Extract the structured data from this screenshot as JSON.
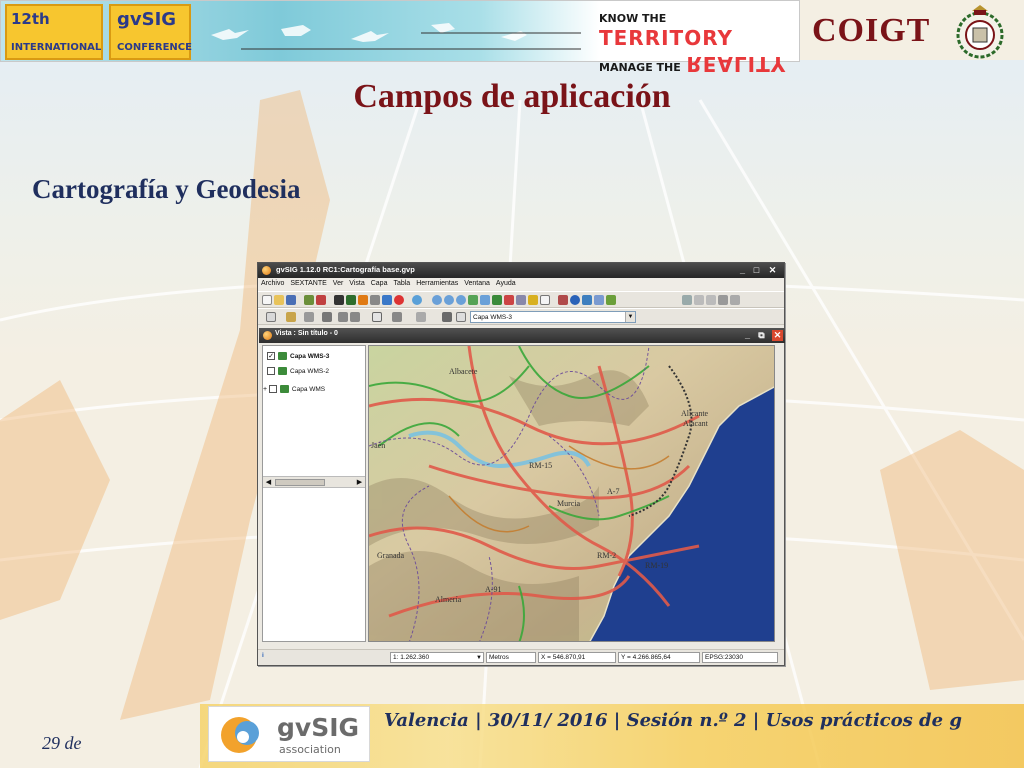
{
  "slide": {
    "title": "Campos de aplicación",
    "subtitle": "Cartografía y Geodesia",
    "org_name": "COIGT",
    "banner": {
      "badge1_line1": "12th",
      "badge1_line2": "INTERNATIONAL",
      "badge2_line1": "gvSIG",
      "badge2_line2": "CONFERENCE",
      "tagline_small_1": "KNOW THE",
      "tagline_large_1": "TERRITORY",
      "tagline_small_2": "MANAGE THE",
      "tagline_large_2": "REALITY"
    },
    "footer": {
      "text": "Valencia | 30/11/ 2016 | Sesión n.º 2 | Usos prácticos de g",
      "page": "29 de",
      "logo_text": "gvSIG",
      "logo_sub": "association"
    }
  },
  "app": {
    "window_title": "gvSIG 1.12.0 RC1:Cartografía base.gvp",
    "menu": [
      "Archivo",
      "SEXTANTE",
      "Ver",
      "Vista",
      "Capa",
      "Tabla",
      "Herramientas",
      "Ventana",
      "Ayuda"
    ],
    "layer_combo_value": "Capa WMS-3",
    "view_title": "Vista : Sin título - 0",
    "layers": [
      {
        "name": "Capa WMS-3",
        "checked": true,
        "selected": true
      },
      {
        "name": "Capa WMS-2",
        "checked": false,
        "selected": false
      },
      {
        "name": "Capa WMS",
        "checked": false,
        "selected": false
      }
    ],
    "status": {
      "scale": "1: 1.262.360",
      "units": "Metros",
      "x": "X = 546.870,91",
      "y": "Y = 4.266.865,64",
      "epsg": "EPSG:23030"
    },
    "map_labels": {
      "albacete": "Albacete",
      "jaen": "Jaén",
      "murcia": "Murcia",
      "granada": "Granada",
      "almeria": "Almería",
      "alicante": "Alicante",
      "alacant": "Alacant",
      "rm2": "RM-2",
      "rm19": "RM-19",
      "a91": "A-91",
      "rm15": "RM-15",
      "a7": "A-7"
    }
  },
  "colors": {
    "title": "#7a1318",
    "subtitle": "#1f2f5e",
    "sea": "#1f3f8f",
    "road_major": "#e05a4a",
    "road_green": "#3aa83a"
  }
}
